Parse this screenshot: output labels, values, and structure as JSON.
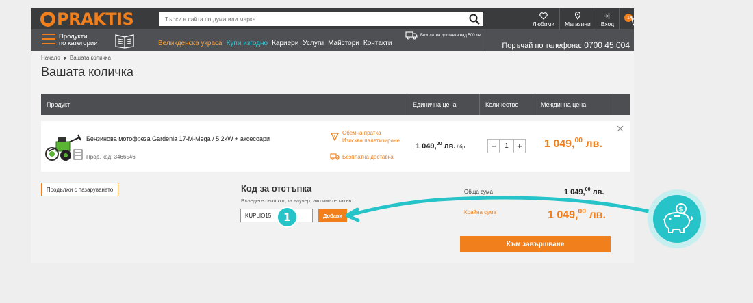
{
  "header": {
    "logo_text": "PRAKTIS",
    "search_placeholder": "Търси в сайта по дума или марка",
    "favorites_label": "Любими",
    "stores_label": "Магазини",
    "login_label": "Вход",
    "cart_count": "1"
  },
  "nav": {
    "categories_line1": "Продукти",
    "categories_line2": "по категории",
    "links": [
      "Великденска украса",
      "Купи изгодно",
      "Кариери",
      "Услуги",
      "Майстори",
      "Контакти"
    ],
    "delivery_text": "Безплатна доставка над 500 лв",
    "phone_label": "Поръчай по телефона:",
    "phone_number": "0700 45 004"
  },
  "breadcrumb": {
    "home": "Начало",
    "current": "Вашата количка"
  },
  "page_title": "Вашата количка",
  "table": {
    "headers": [
      "Продукт",
      "Единична цена",
      "Количество",
      "Междинна цена"
    ],
    "row": {
      "name": "Бензинова мотофреза Gardenia 17-M-Mega / 5,2kW + аксесоари",
      "code": "Прод. код: 3466546",
      "note_bulky_1": "Обемна пратка",
      "note_bulky_2": "Изисква палетизиране",
      "note_delivery": "Безплатна доставка",
      "unit_price_int": "1 049,",
      "unit_price_dec": "00",
      "unit_price_cur": " лв.",
      "unit_price_per": " / бр",
      "quantity": "1",
      "subtotal_int": "1 049,",
      "subtotal_dec": "00",
      "subtotal_cur": " лв."
    }
  },
  "continue_label": "Продължи с пазаруването",
  "discount": {
    "title": "Код за отстъпка",
    "help": "Въведете своя код за ваучер, ако имате такъв.",
    "value": "KUPLIO15",
    "apply_label": "Добави"
  },
  "totals": {
    "sum_label": "Обща сума",
    "sum_int": "1 049,",
    "sum_dec": "00",
    "sum_cur": " лв.",
    "final_label": "Крайна сума",
    "final_int": "1 049,",
    "final_dec": "00",
    "final_cur": " лв."
  },
  "finish_label": "Към завършване",
  "annotation": {
    "step_number": "1"
  },
  "colors": {
    "brand_orange": "#f07f1c",
    "accent_teal": "#26c3c8",
    "header_dark": "#3a3b3d"
  }
}
